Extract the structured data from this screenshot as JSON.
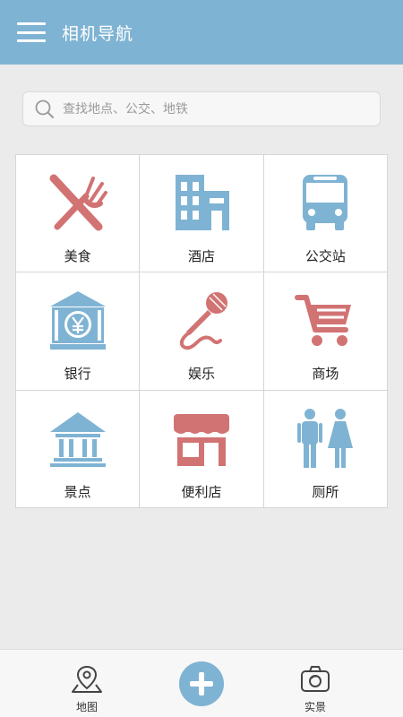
{
  "header": {
    "title": "相机导航",
    "menu_icon": "hamburger-icon"
  },
  "search": {
    "placeholder": "查找地点、公交、地铁",
    "icon": "search-icon"
  },
  "categories": [
    {
      "label": "美食",
      "icon": "fork-knife-icon"
    },
    {
      "label": "酒店",
      "icon": "hotel-icon"
    },
    {
      "label": "公交站",
      "icon": "bus-icon"
    },
    {
      "label": "银行",
      "icon": "bank-icon"
    },
    {
      "label": "娱乐",
      "icon": "microphone-icon"
    },
    {
      "label": "商场",
      "icon": "shopping-cart-icon"
    },
    {
      "label": "景点",
      "icon": "pavilion-icon"
    },
    {
      "label": "便利店",
      "icon": "store-icon"
    },
    {
      "label": "厕所",
      "icon": "restroom-icon"
    }
  ],
  "bottom_nav": {
    "map": {
      "label": "地图",
      "icon": "map-pin-icon"
    },
    "add": {
      "icon": "plus-icon"
    },
    "live": {
      "label": "实景",
      "icon": "camera-icon"
    }
  },
  "colors": {
    "blue": "#7fb3d3",
    "red": "#d27373",
    "background": "#ebebeb"
  }
}
